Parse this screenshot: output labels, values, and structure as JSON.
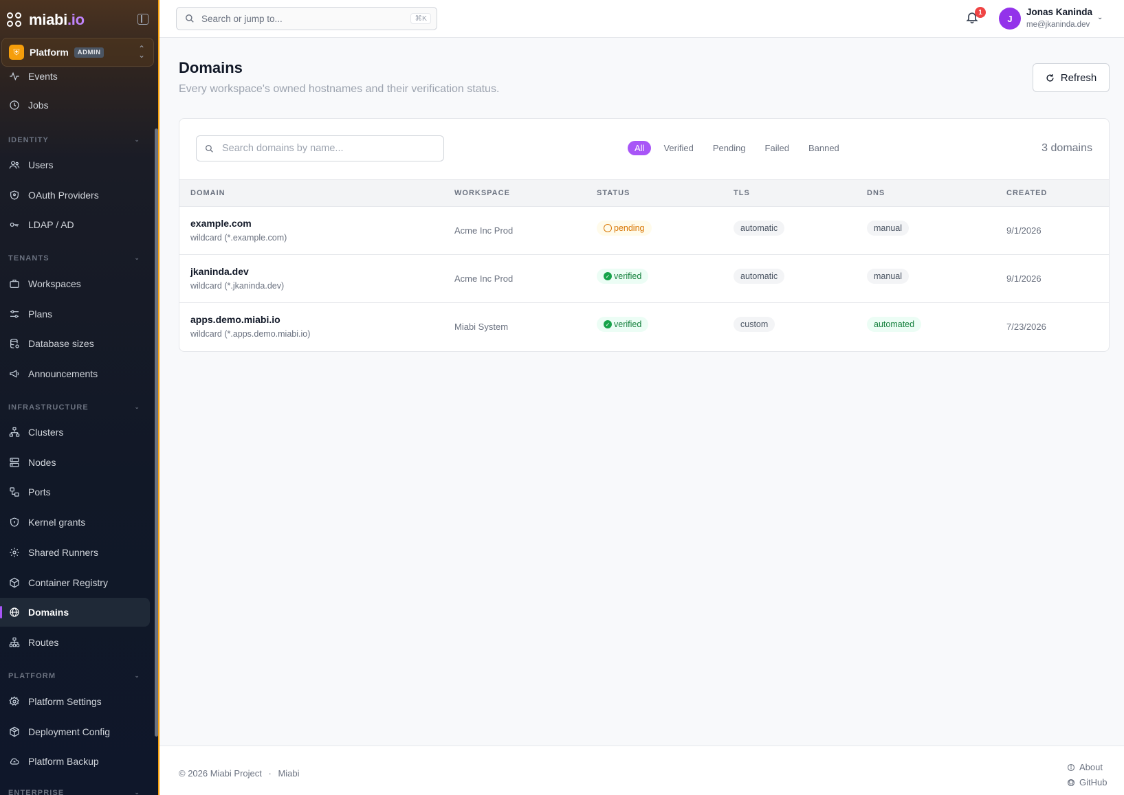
{
  "brand": {
    "name_main": "miabi",
    "name_accent": ".io"
  },
  "tenant": {
    "name": "Platform",
    "badge": "ADMIN"
  },
  "sidebar": {
    "top_items": [
      {
        "label": "Events",
        "icon": "activity-icon"
      },
      {
        "label": "Jobs",
        "icon": "clock-icon"
      }
    ],
    "sections": [
      {
        "title": "IDENTITY",
        "items": [
          {
            "label": "Users",
            "icon": "users-icon"
          },
          {
            "label": "OAuth Providers",
            "icon": "shield-icon"
          },
          {
            "label": "LDAP / AD",
            "icon": "key-icon"
          }
        ]
      },
      {
        "title": "TENANTS",
        "items": [
          {
            "label": "Workspaces",
            "icon": "briefcase-icon"
          },
          {
            "label": "Plans",
            "icon": "sliders-icon"
          },
          {
            "label": "Database sizes",
            "icon": "database-icon"
          },
          {
            "label": "Announcements",
            "icon": "megaphone-icon"
          }
        ]
      },
      {
        "title": "INFRASTRUCTURE",
        "items": [
          {
            "label": "Clusters",
            "icon": "network-icon"
          },
          {
            "label": "Nodes",
            "icon": "server-icon"
          },
          {
            "label": "Ports",
            "icon": "ports-icon"
          },
          {
            "label": "Kernel grants",
            "icon": "shield-lock-icon"
          },
          {
            "label": "Shared Runners",
            "icon": "cog-icon"
          },
          {
            "label": "Container Registry",
            "icon": "box-icon"
          },
          {
            "label": "Domains",
            "icon": "globe-icon",
            "active": true
          },
          {
            "label": "Routes",
            "icon": "sitemap-icon"
          }
        ]
      },
      {
        "title": "PLATFORM",
        "items": [
          {
            "label": "Platform Settings",
            "icon": "settings-icon"
          },
          {
            "label": "Deployment Config",
            "icon": "package-icon"
          },
          {
            "label": "Platform Backup",
            "icon": "cloud-icon"
          }
        ]
      },
      {
        "title": "ENTERPRISE",
        "items": []
      }
    ]
  },
  "header": {
    "search_placeholder": "Search or jump to...",
    "search_shortcut": "⌘K",
    "notifications_count": "1",
    "user": {
      "initial": "J",
      "name": "Jonas Kaninda",
      "email": "me@jkaninda.dev"
    }
  },
  "page": {
    "title": "Domains",
    "subtitle": "Every workspace's owned hostnames and their verification status.",
    "refresh_label": "Refresh"
  },
  "filters": {
    "search_placeholder": "Search domains by name...",
    "chips": [
      "All",
      "Verified",
      "Pending",
      "Failed",
      "Banned"
    ],
    "active_chip": "All",
    "count_label": "3 domains"
  },
  "table": {
    "columns": [
      "DOMAIN",
      "WORKSPACE",
      "STATUS",
      "TLS",
      "DNS",
      "CREATED"
    ],
    "rows": [
      {
        "domain": "example.com",
        "wildcard": "wildcard (*.example.com)",
        "workspace": "Acme Inc Prod",
        "status": "pending",
        "tls": "automatic",
        "dns": "manual",
        "created": "9/1/2026"
      },
      {
        "domain": "jkaninda.dev",
        "wildcard": "wildcard (*.jkaninda.dev)",
        "workspace": "Acme Inc Prod",
        "status": "verified",
        "tls": "automatic",
        "dns": "manual",
        "created": "9/1/2026"
      },
      {
        "domain": "apps.demo.miabi.io",
        "wildcard": "wildcard (*.apps.demo.miabi.io)",
        "workspace": "Miabi System",
        "status": "verified",
        "tls": "custom",
        "dns": "automated",
        "created": "7/23/2026"
      }
    ]
  },
  "footer": {
    "copyright": "© 2026 Miabi Project",
    "separator": "·",
    "brand": "Miabi",
    "about": "About",
    "github": "GitHub"
  },
  "colors": {
    "accent": "#a855f7",
    "tenant": "#f59e0b",
    "success": "#16a34a",
    "warning": "#d97706",
    "danger": "#ef4444"
  }
}
